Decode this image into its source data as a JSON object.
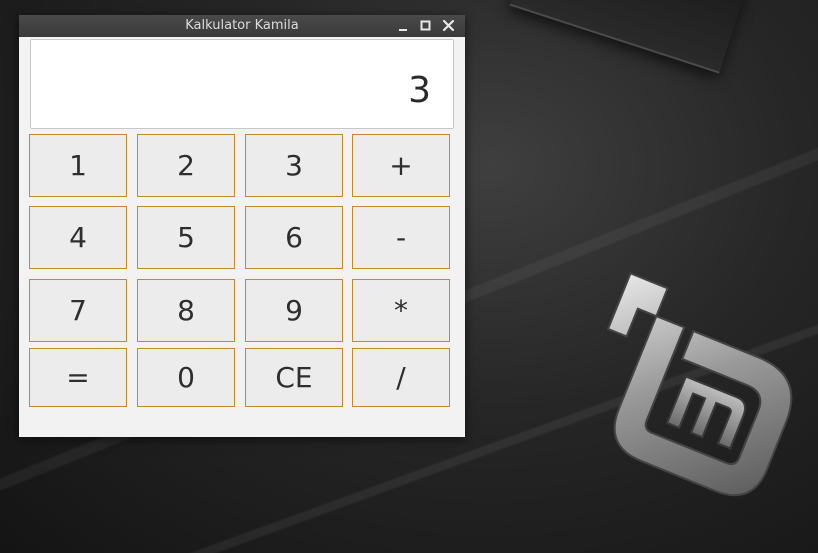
{
  "window": {
    "title": "Kalkulator Kamila",
    "controls": {
      "minimize": "minimize-icon",
      "maximize": "maximize-icon",
      "close": "close-icon"
    }
  },
  "display": {
    "value": "3"
  },
  "keypad": {
    "keys": [
      "1",
      "2",
      "3",
      "+",
      "4",
      "5",
      "6",
      "-",
      "7",
      "8",
      "9",
      "*",
      "=",
      "0",
      "CE",
      "/"
    ]
  },
  "colors": {
    "key_border": "#c8872c",
    "key_background": "#ececec",
    "titlebar": "#3f3f3f"
  }
}
